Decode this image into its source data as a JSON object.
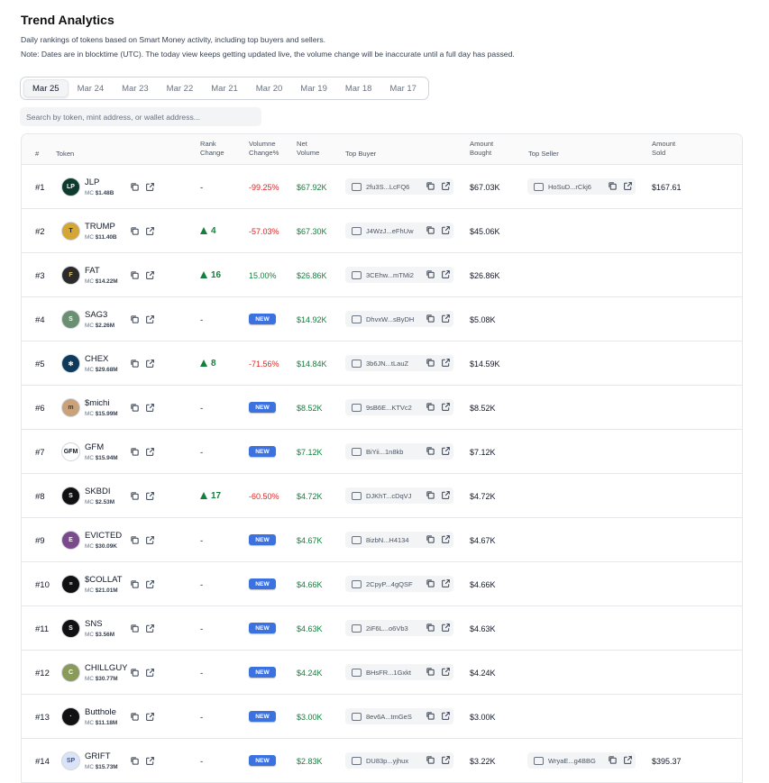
{
  "page": {
    "title": "Trend Analytics",
    "desc1": "Daily rankings of tokens based on Smart Money activity, including top buyers and sellers.",
    "desc2": "Note: Dates are in blocktime (UTC). The today view keeps getting updated live, the volume change will be inaccurate until a full day has passed."
  },
  "tabs": [
    "Mar 25",
    "Mar 24",
    "Mar 23",
    "Mar 22",
    "Mar 21",
    "Mar 20",
    "Mar 19",
    "Mar 18",
    "Mar 17"
  ],
  "active_tab": 0,
  "search": {
    "placeholder": "Search by token, mint address, or wallet address..."
  },
  "columns": {
    "num": "#",
    "token": "Token",
    "rank_change": [
      "Rank",
      "Change"
    ],
    "volume_change": [
      "Volumne",
      "Change%"
    ],
    "net_volume": [
      "Net",
      "Volume"
    ],
    "top_buyer": "Top Buyer",
    "amount_bought": [
      "Amount",
      "Bought"
    ],
    "top_seller": "Top Seller",
    "amount_sold": [
      "Amount",
      "Sold"
    ]
  },
  "mc_label": "MC",
  "new_label": "NEW",
  "colors": {
    "accent_new": "#3b72e0",
    "positive": "#15803d",
    "negative": "#dc2626"
  },
  "rows": [
    {
      "rank": "#1",
      "symbol": "JLP",
      "mc": "$1.48B",
      "logo": "LP",
      "logo_bg": "#0f3b2e",
      "logo_fg": "#ffffff",
      "rank_change": "-",
      "rank_dir": "none",
      "vol_change": "-99.25%",
      "vol_sign": "neg",
      "net_volume": "$67.92K",
      "buyer": "2fu3S...LcFQ6",
      "bought": "$67.03K",
      "seller": "HoSuD...rCkj6",
      "sold": "$167.61"
    },
    {
      "rank": "#2",
      "symbol": "TRUMP",
      "mc": "$11.40B",
      "logo": "T",
      "logo_bg": "#d4a537",
      "logo_fg": "#1f2937",
      "rank_change": "4",
      "rank_dir": "up",
      "vol_change": "-57.03%",
      "vol_sign": "neg",
      "net_volume": "$67.30K",
      "buyer": "J4WzJ...eFhUw",
      "bought": "$45.06K",
      "seller": "",
      "sold": ""
    },
    {
      "rank": "#3",
      "symbol": "FAT",
      "mc": "$14.22M",
      "logo": "F",
      "logo_bg": "#2b2b2b",
      "logo_fg": "#f3c14b",
      "rank_change": "16",
      "rank_dir": "up",
      "vol_change": "15.00%",
      "vol_sign": "pos",
      "net_volume": "$26.86K",
      "buyer": "3CEhw...mTMi2",
      "bought": "$26.86K",
      "seller": "",
      "sold": ""
    },
    {
      "rank": "#4",
      "symbol": "SAG3",
      "mc": "$2.26M",
      "logo": "S",
      "logo_bg": "#6b8f71",
      "logo_fg": "#ffffff",
      "rank_change": "-",
      "rank_dir": "new",
      "vol_change": "",
      "vol_sign": "",
      "net_volume": "$14.92K",
      "buyer": "DhvxW...sByDH",
      "bought": "$5.08K",
      "seller": "",
      "sold": ""
    },
    {
      "rank": "#5",
      "symbol": "CHEX",
      "mc": "$29.68M",
      "logo": "✻",
      "logo_bg": "#0e3a5c",
      "logo_fg": "#ffffff",
      "rank_change": "8",
      "rank_dir": "up",
      "vol_change": "-71.56%",
      "vol_sign": "neg",
      "net_volume": "$14.84K",
      "buyer": "3b6JN...tLauZ",
      "bought": "$14.59K",
      "seller": "",
      "sold": ""
    },
    {
      "rank": "#6",
      "symbol": "$michi",
      "mc": "$15.99M",
      "logo": "m",
      "logo_bg": "#c9a27a",
      "logo_fg": "#4b3621",
      "rank_change": "-",
      "rank_dir": "new",
      "vol_change": "",
      "vol_sign": "",
      "net_volume": "$8.52K",
      "buyer": "9sB6E...KTVc2",
      "bought": "$8.52K",
      "seller": "",
      "sold": ""
    },
    {
      "rank": "#7",
      "symbol": "GFM",
      "mc": "$15.94M",
      "logo": "GFM",
      "logo_bg": "#ffffff",
      "logo_fg": "#111827",
      "rank_change": "-",
      "rank_dir": "new",
      "vol_change": "",
      "vol_sign": "",
      "net_volume": "$7.12K",
      "buyer": "BiYii...1n8kb",
      "bought": "$7.12K",
      "seller": "",
      "sold": ""
    },
    {
      "rank": "#8",
      "symbol": "SKBDI",
      "mc": "$2.53M",
      "logo": "S",
      "logo_bg": "#111111",
      "logo_fg": "#ffffff",
      "rank_change": "17",
      "rank_dir": "up",
      "vol_change": "-60.50%",
      "vol_sign": "neg",
      "net_volume": "$4.72K",
      "buyer": "DJKhT...cDqVJ",
      "bought": "$4.72K",
      "seller": "",
      "sold": ""
    },
    {
      "rank": "#9",
      "symbol": "EVICTED",
      "mc": "$30.09K",
      "logo": "E",
      "logo_bg": "#7b4a8c",
      "logo_fg": "#ffffff",
      "rank_change": "-",
      "rank_dir": "new",
      "vol_change": "",
      "vol_sign": "",
      "net_volume": "$4.67K",
      "buyer": "8izbN...H4134",
      "bought": "$4.67K",
      "seller": "",
      "sold": ""
    },
    {
      "rank": "#10",
      "symbol": "$COLLAT",
      "mc": "$21.01M",
      "logo": "≡",
      "logo_bg": "#111111",
      "logo_fg": "#ffffff",
      "rank_change": "-",
      "rank_dir": "new",
      "vol_change": "",
      "vol_sign": "",
      "net_volume": "$4.66K",
      "buyer": "2CpyP...4gQSF",
      "bought": "$4.66K",
      "seller": "",
      "sold": ""
    },
    {
      "rank": "#11",
      "symbol": "SNS",
      "mc": "$3.56M",
      "logo": "S",
      "logo_bg": "#111111",
      "logo_fg": "#ffffff",
      "rank_change": "-",
      "rank_dir": "new",
      "vol_change": "",
      "vol_sign": "",
      "net_volume": "$4.63K",
      "buyer": "2iF6L...o6Vb3",
      "bought": "$4.63K",
      "seller": "",
      "sold": ""
    },
    {
      "rank": "#12",
      "symbol": "CHILLGUY",
      "mc": "$30.77M",
      "logo": "C",
      "logo_bg": "#8a9a5b",
      "logo_fg": "#ffffff",
      "rank_change": "-",
      "rank_dir": "new",
      "vol_change": "",
      "vol_sign": "",
      "net_volume": "$4.24K",
      "buyer": "BHsFR...1Gxkt",
      "bought": "$4.24K",
      "seller": "",
      "sold": ""
    },
    {
      "rank": "#13",
      "symbol": "Butthole",
      "mc": "$11.18M",
      "logo": "·",
      "logo_bg": "#111111",
      "logo_fg": "#ffffff",
      "rank_change": "-",
      "rank_dir": "new",
      "vol_change": "",
      "vol_sign": "",
      "net_volume": "$3.00K",
      "buyer": "8ev6A...tmGeS",
      "bought": "$3.00K",
      "seller": "",
      "sold": ""
    },
    {
      "rank": "#14",
      "symbol": "GRIFT",
      "mc": "$15.73M",
      "logo": "SP",
      "logo_bg": "#dbe4f7",
      "logo_fg": "#3b4fc4",
      "rank_change": "-",
      "rank_dir": "new",
      "vol_change": "",
      "vol_sign": "",
      "net_volume": "$2.83K",
      "buyer": "DU83p...yjhux",
      "bought": "$3.22K",
      "seller": "WryaE...g4BBG",
      "sold": "$395.37"
    }
  ]
}
